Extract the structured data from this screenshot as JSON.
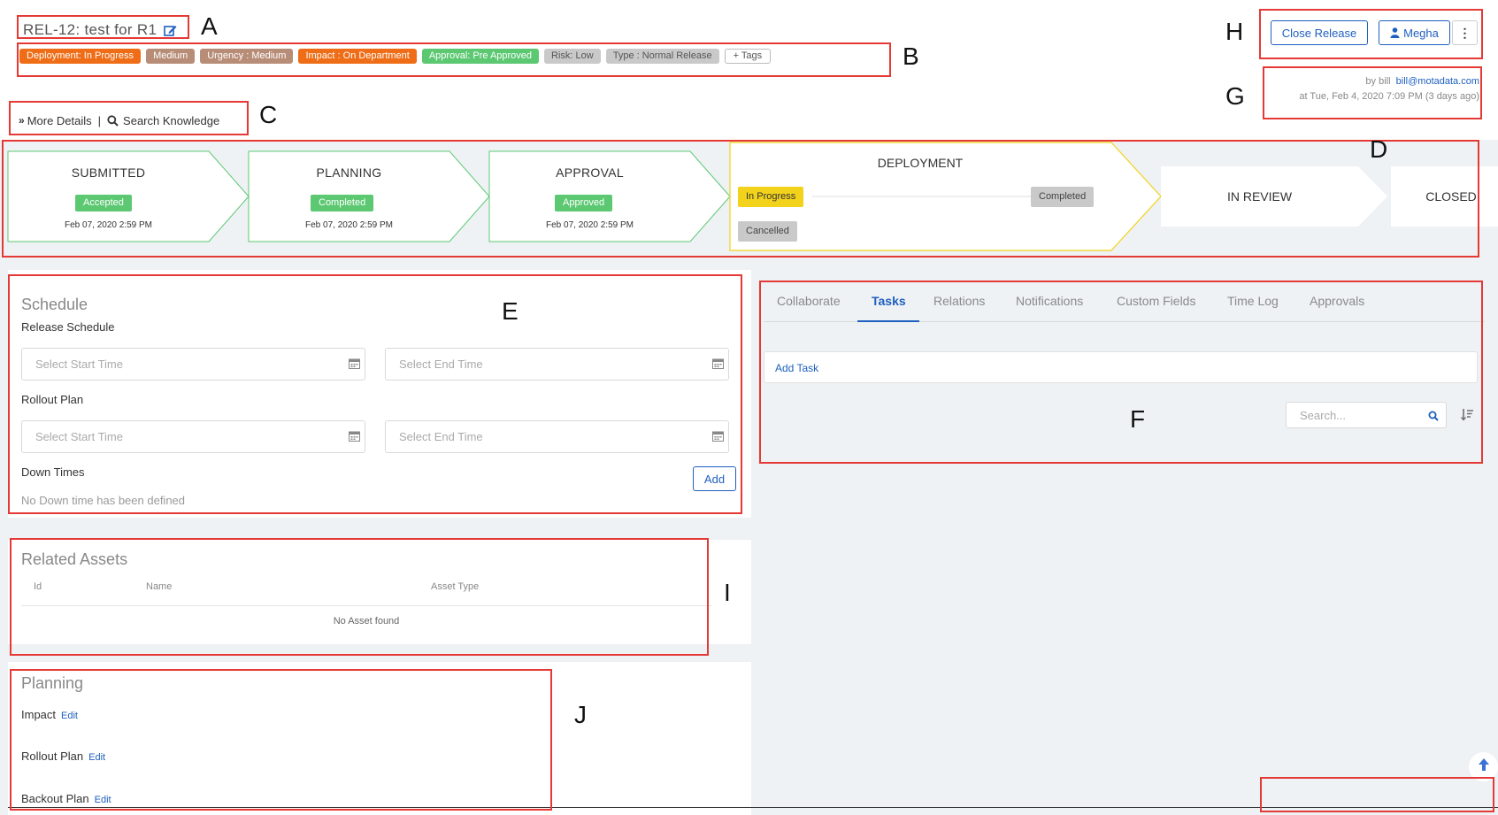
{
  "header": {
    "title": "REL-12: test for R1",
    "tags": [
      {
        "label": "Deployment: In Progress",
        "color": "#ee6d16"
      },
      {
        "label": "Medium",
        "color": "#b88d78"
      },
      {
        "label": "Urgency : Medium",
        "color": "#b88d78"
      },
      {
        "label": "Impact : On Department",
        "color": "#ee6d16"
      },
      {
        "label": "Approval: Pre Approved",
        "color": "#5cc872"
      },
      {
        "label": "Risk: Low",
        "color": "#bdbdbd"
      },
      {
        "label": "Type : Normal Release",
        "color": "#bdbdbd"
      }
    ],
    "add_tags_label": "+ Tags",
    "more_details_label": "More Details",
    "separator": "|",
    "search_knowledge_label": "Search Knowledge"
  },
  "actions": {
    "close_release_label": "Close Release",
    "assignee_label": "Megha"
  },
  "meta": {
    "by_prefix": "by bill",
    "email": "bill@motadata.com",
    "created_at": "at Tue, Feb 4, 2020 7:09 PM (3 days ago)"
  },
  "workflow": {
    "submitted": {
      "title": "SUBMITTED",
      "status": "Accepted",
      "date": "Feb 07, 2020 2:59 PM"
    },
    "planning": {
      "title": "PLANNING",
      "status": "Completed",
      "date": "Feb 07, 2020 2:59 PM"
    },
    "approval": {
      "title": "APPROVAL",
      "status": "Approved",
      "date": "Feb 07, 2020 2:59 PM"
    },
    "deployment": {
      "title": "DEPLOYMENT",
      "in_progress": "In Progress",
      "completed": "Completed",
      "cancelled": "Cancelled"
    },
    "in_review": {
      "title": "IN REVIEW"
    },
    "closed": {
      "title": "CLOSED"
    }
  },
  "schedule": {
    "title": "Schedule",
    "release_schedule_label": "Release Schedule",
    "rollout_plan_label": "Rollout Plan",
    "start_placeholder": "Select Start Time",
    "end_placeholder": "Select End Time",
    "down_times_label": "Down Times",
    "add_label": "Add",
    "no_down_time": "No Down time has been defined"
  },
  "assets": {
    "title": "Related Assets",
    "columns": [
      "Id",
      "Name",
      "Asset Type"
    ],
    "empty": "No Asset found"
  },
  "planning": {
    "title": "Planning",
    "impact_label": "Impact",
    "rollout_label": "Rollout Plan",
    "backout_label": "Backout Plan",
    "edit_label": "Edit"
  },
  "tabs": {
    "items": [
      "Collaborate",
      "Tasks",
      "Relations",
      "Notifications",
      "Custom Fields",
      "Time Log",
      "Approvals"
    ],
    "active": "Tasks",
    "add_task_label": "Add Task",
    "search_placeholder": "Search..."
  },
  "callouts": {
    "A": "A",
    "B": "B",
    "C": "C",
    "D": "D",
    "E": "E",
    "F": "F",
    "G": "G",
    "H": "H",
    "I": "I",
    "J": "J"
  }
}
